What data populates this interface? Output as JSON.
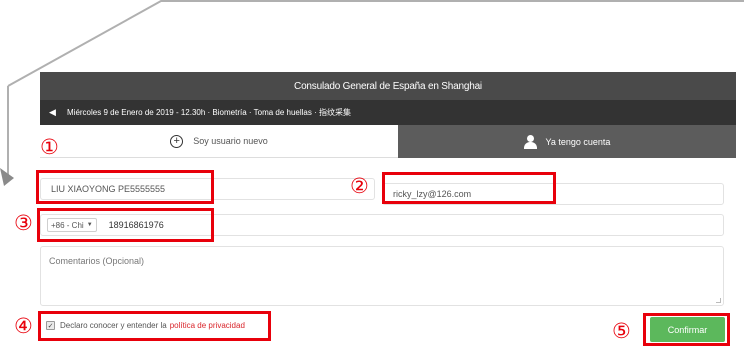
{
  "app": {
    "title": "Consulado General de España en Shanghai",
    "appointment_info": "Miércoles 9 de Enero de 2019 - 12.30h · Biometría · Toma de huellas · 指纹采集"
  },
  "tabs": {
    "new_user": "Soy usuario nuevo",
    "existing_account": "Ya tengo cuenta"
  },
  "form": {
    "name_value": "LIU XIAOYONG PE5555555",
    "email_value": "ricky_lzy@126.com",
    "country_code": "+86 - Chi",
    "phone_value": "18916861976",
    "comments_placeholder": "Comentarios (Opcional)",
    "consent_text": "Declaro conocer y entender la",
    "privacy_link": "política de privacidad",
    "confirm_label": "Confirmar"
  },
  "markers": {
    "m1": "①",
    "m2": "②",
    "m3": "③",
    "m4": "④",
    "m5": "⑤"
  },
  "colors": {
    "callout": "#e8000b",
    "confirm": "#5cb85c",
    "header": "#4a4a4a",
    "info_bar": "#333333",
    "account_tab": "#5c5c5c",
    "link": "#d9252b"
  }
}
